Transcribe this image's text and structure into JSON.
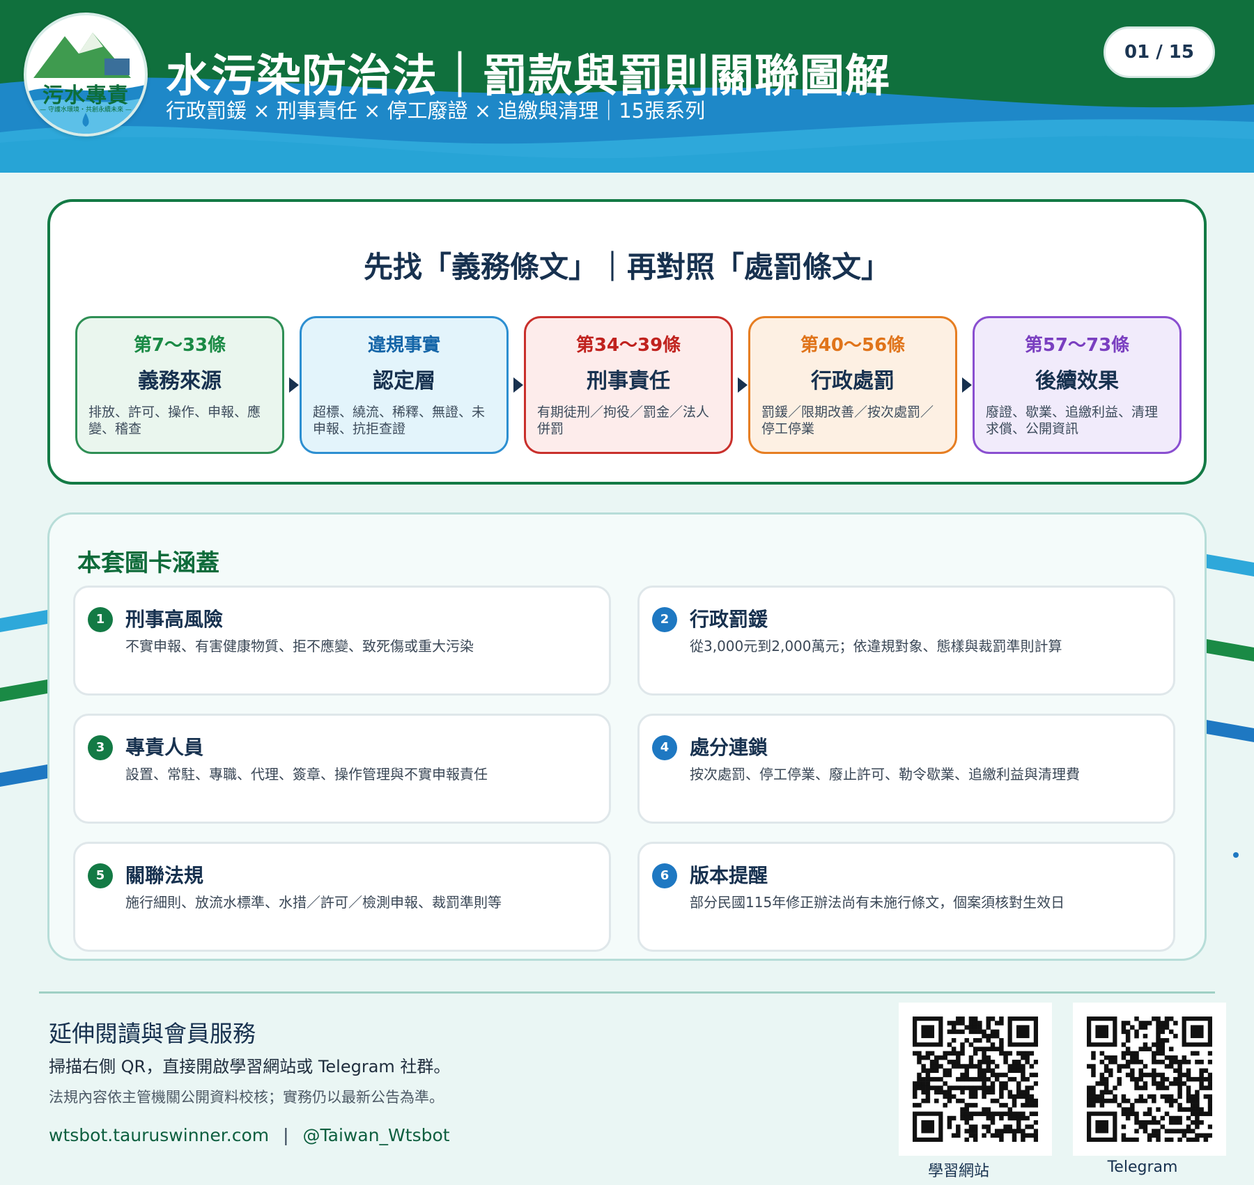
{
  "header": {
    "logo_text": "污水專責",
    "logo_slogan": "— 守護水環境・共創永續未來 —",
    "title": "水污染防治法｜罰款與罰則關聯圖解",
    "subtitle": "行政罰鍰 × 刑事責任 × 停工廢證 × 追繳與清理｜15張系列",
    "page_indicator": "01 / 15"
  },
  "colors": {
    "header_green": "#10703d",
    "header_blue": "#1e88c8",
    "accent_green": "#137a45",
    "navy": "#17314f"
  },
  "flow": {
    "title": "先找「義務條文」｜再對照「處罰條文」",
    "steps": [
      {
        "article": "第7～33條",
        "name": "義務來源",
        "desc": "排放、許可、操作、申報、應變、稽查",
        "color": "#1a8a45",
        "bg": "#eaf6ee",
        "border": "#2f8f55"
      },
      {
        "article": "違規事實",
        "name": "認定層",
        "desc": "超標、繞流、稀釋、無證、未申報、抗拒查證",
        "color": "#1465a8",
        "bg": "#e3f4fb",
        "border": "#2d8fd1"
      },
      {
        "article": "第34～39條",
        "name": "刑事責任",
        "desc": "有期徒刑／拘役／罰金／法人併罰",
        "color": "#c0221e",
        "bg": "#fdeceb",
        "border": "#c9302c"
      },
      {
        "article": "第40～56條",
        "name": "行政處罰",
        "desc": "罰鍰／限期改善／按次處罰／停工停業",
        "color": "#e0741a",
        "bg": "#fdf0e3",
        "border": "#e67e22"
      },
      {
        "article": "第57～73條",
        "name": "後續效果",
        "desc": "廢證、歇業、追繳利益、清理求償、公開資訊",
        "color": "#7a3fc0",
        "bg": "#f1ebfb",
        "border": "#8a4fd0"
      }
    ]
  },
  "coverage": {
    "title": "本套圖卡涵蓋",
    "items": [
      {
        "num": "1",
        "title": "刑事高風險",
        "desc": "不實申報、有害健康物質、拒不應變、致死傷或重大污染",
        "color": "#137a45"
      },
      {
        "num": "2",
        "title": "行政罰鍰",
        "desc": "從3,000元到2,000萬元；依違規對象、態樣與裁罰準則計算",
        "color": "#1e78c2"
      },
      {
        "num": "3",
        "title": "專責人員",
        "desc": "設置、常駐、專職、代理、簽章、操作管理與不實申報責任",
        "color": "#137a45"
      },
      {
        "num": "4",
        "title": "處分連鎖",
        "desc": "按次處罰、停工停業、廢止許可、勒令歇業、追繳利益與清理費",
        "color": "#1e78c2"
      },
      {
        "num": "5",
        "title": "關聯法規",
        "desc": "施行細則、放流水標準、水措／許可／檢測申報、裁罰準則等",
        "color": "#137a45"
      },
      {
        "num": "6",
        "title": "版本提醒",
        "desc": "部分民國115年修正辦法尚有未施行條文，個案須核對生效日",
        "color": "#1e78c2"
      }
    ]
  },
  "footer": {
    "title": "延伸閱讀與會員服務",
    "line1": "掃描右側 QR，直接開啟學習網站或 Telegram 社群。",
    "line2": "法規內容依主管機關公開資料校核；實務仍以最新公告為準。",
    "website": "wtsbot.tauruswinner.com",
    "separator": "|",
    "telegram_handle": "@Taiwan_Wtsbot",
    "qr_website_label": "學習網站",
    "qr_telegram_label": "Telegram"
  }
}
